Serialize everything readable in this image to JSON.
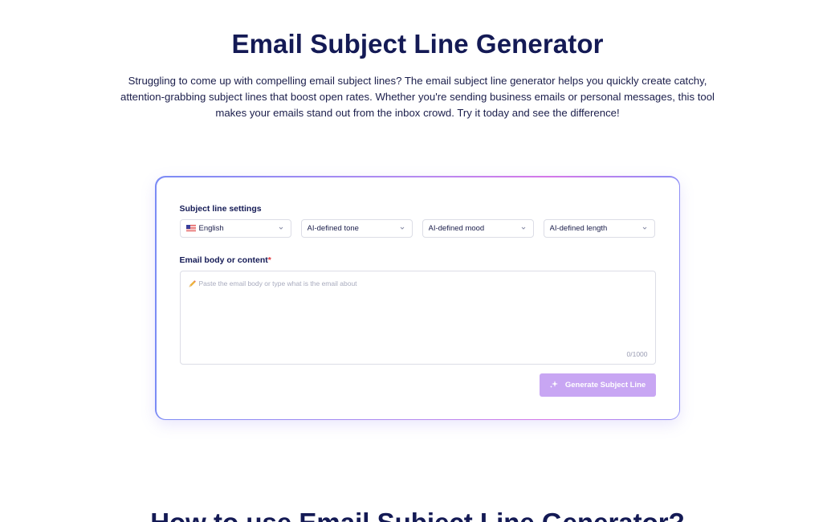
{
  "hero": {
    "title": "Email Subject Line Generator",
    "description": "Struggling to come up with compelling email subject lines? The email subject line generator helps you quickly create catchy, attention-grabbing subject lines that boost open rates. Whether you're sending business emails or personal messages, this tool makes your emails stand out from the inbox crowd. Try it today and see the difference!"
  },
  "form": {
    "settings_label": "Subject line settings",
    "selects": {
      "language": "English",
      "tone": "AI-defined tone",
      "mood": "AI-defined mood",
      "length": "AI-defined length"
    },
    "body_label": "Email body or content",
    "required_marker": "*",
    "body_placeholder": "Paste the email body or type what is the email about",
    "body_value": "",
    "char_counter": "0/1000",
    "generate_label": "Generate Subject Line"
  },
  "next_section": {
    "title": "How to use Email Subject Line Generator?"
  },
  "colors": {
    "heading": "#141a55",
    "button_disabled": "#c8a6f3",
    "required": "#e0343b"
  },
  "icons": {
    "flag": "us-flag-icon",
    "chevron": "chevron-down-icon",
    "pencil": "pencil-icon",
    "sparkle": "sparkle-icon"
  }
}
